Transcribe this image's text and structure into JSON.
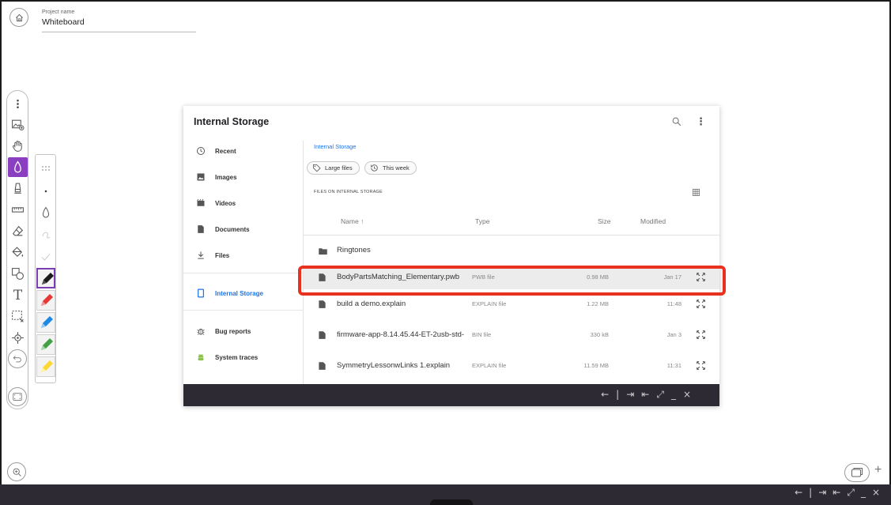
{
  "project": {
    "label": "Project name",
    "name": "Whiteboard"
  },
  "toolbar": {
    "tools": [
      {
        "name": "more-icon"
      },
      {
        "name": "insert-image-icon"
      },
      {
        "name": "pan-hand-icon"
      },
      {
        "name": "pen-icon",
        "active": true
      },
      {
        "name": "highlighter-icon"
      },
      {
        "name": "ruler-icon"
      },
      {
        "name": "eraser-icon"
      },
      {
        "name": "fill-bucket-icon"
      },
      {
        "name": "shapes-icon"
      },
      {
        "name": "text-icon",
        "glyph": "T"
      },
      {
        "name": "lasso-select-icon"
      },
      {
        "name": "laser-pointer-icon"
      },
      {
        "name": "undo-icon"
      },
      {
        "name": "fit-screen-icon"
      }
    ]
  },
  "pen_panel": {
    "colors": [
      "#1a1a1a",
      "#e53935",
      "#1e88e5",
      "#43a047",
      "#fdd835"
    ],
    "selected_color": "#1a1a1a"
  },
  "dialog": {
    "title": "Internal Storage",
    "sidebar": [
      {
        "label": "Recent",
        "icon": "clock-icon"
      },
      {
        "label": "Images",
        "icon": "image-icon"
      },
      {
        "label": "Videos",
        "icon": "video-icon"
      },
      {
        "label": "Documents",
        "icon": "document-icon"
      },
      {
        "label": "Files",
        "icon": "download-icon"
      },
      {
        "label": "Internal Storage",
        "icon": "phone-icon",
        "selected": true
      },
      {
        "label": "Bug reports",
        "icon": "bug-icon"
      },
      {
        "label": "System traces",
        "icon": "android-icon"
      }
    ],
    "breadcrumb": "Internal Storage",
    "chips": [
      {
        "label": "Large files",
        "icon": "tag-icon"
      },
      {
        "label": "This week",
        "icon": "history-icon"
      }
    ],
    "section_title": "FILES ON INTERNAL STORAGE",
    "columns": {
      "name": "Name ↑",
      "type": "Type",
      "size": "Size",
      "modified": "Modified"
    },
    "files": [
      {
        "name": "Ringtones",
        "type": "",
        "size": "",
        "modified": "",
        "kind": "folder"
      },
      {
        "name": "BodyPartsMatching_Elementary.pwb",
        "type": "PWB file",
        "size": "0.98 MB",
        "modified": "Jan 17",
        "kind": "file",
        "highlight": true
      },
      {
        "name": "build a demo.explain",
        "type": "EXPLAIN file",
        "size": "1.22 MB",
        "modified": "11:48",
        "kind": "file"
      },
      {
        "name": "firmware-app-8.14.45.44-ET-2usb-std-",
        "type": "BIN file",
        "size": "330 kB",
        "modified": "Jan 3",
        "kind": "file"
      },
      {
        "name": "SymmetryLessonwLinks 1.explain",
        "type": "EXPLAIN file",
        "size": "11.59 MB",
        "modified": "11:31",
        "kind": "file"
      }
    ]
  },
  "colors": {
    "accent_purple": "#8a3fc1",
    "link_blue": "#1a73e8",
    "highlight_red": "#e8321f",
    "bar_dark": "#2e2a33"
  },
  "window_controls": [
    "←",
    "|",
    "⇥",
    "⇤",
    "⤢",
    "_",
    "×"
  ]
}
